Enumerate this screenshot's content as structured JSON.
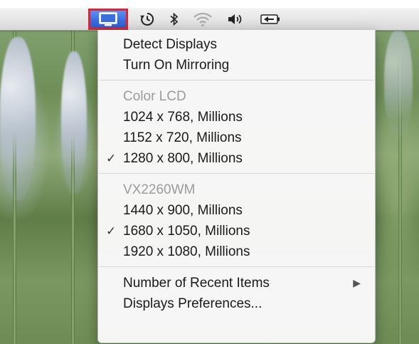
{
  "menubar": {
    "icons": [
      {
        "name": "displays-icon",
        "selected": true
      },
      {
        "name": "time-machine-icon"
      },
      {
        "name": "bluetooth-icon"
      },
      {
        "name": "wifi-icon"
      },
      {
        "name": "volume-icon"
      },
      {
        "name": "battery-icon"
      }
    ],
    "highlight_color": "#3b6fe0",
    "selection_outline_color": "#e0242a"
  },
  "menu": {
    "actions": {
      "detect_displays": "Detect Displays",
      "turn_on_mirroring": "Turn On Mirroring"
    },
    "displays": [
      {
        "name": "Color LCD",
        "resolutions": [
          {
            "label": "1024 x 768, Millions",
            "checked": false
          },
          {
            "label": "1152 x 720, Millions",
            "checked": false
          },
          {
            "label": "1280 x 800, Millions",
            "checked": true
          }
        ]
      },
      {
        "name": "VX2260WM",
        "resolutions": [
          {
            "label": "1440 x 900, Millions",
            "checked": false
          },
          {
            "label": "1680 x 1050, Millions",
            "checked": true
          },
          {
            "label": "1920 x 1080, Millions",
            "checked": false
          }
        ]
      }
    ],
    "footer": {
      "recent_items": "Number of Recent Items",
      "preferences": "Displays Preferences..."
    },
    "check_glyph": "✓",
    "submenu_glyph": "▶"
  }
}
